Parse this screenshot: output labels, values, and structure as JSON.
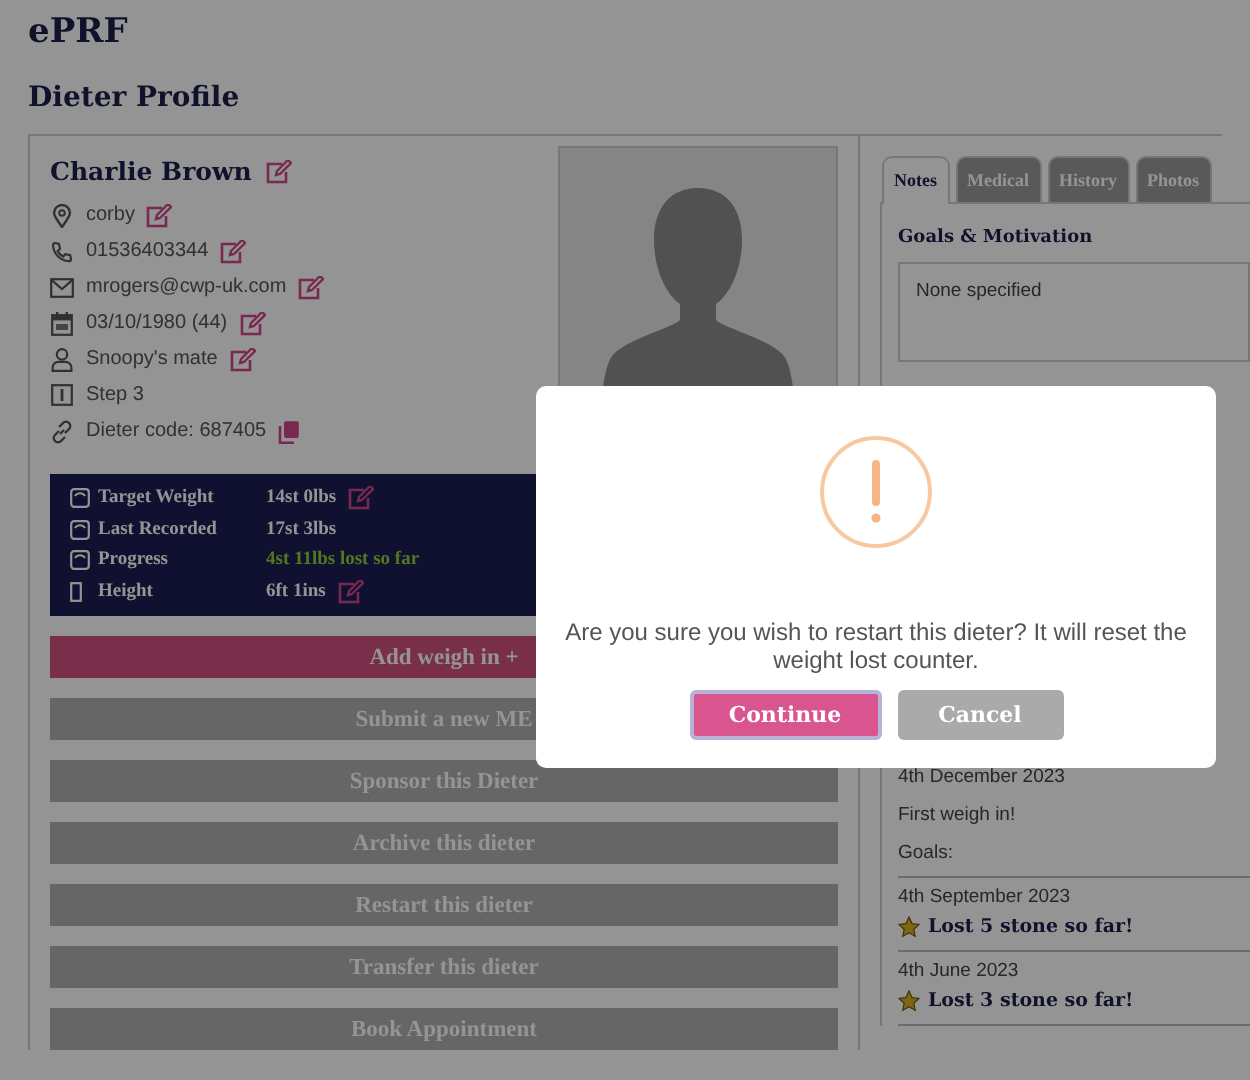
{
  "app": {
    "title": "ePRF"
  },
  "page_title": "Dieter Profile",
  "dieter": {
    "name": "Charlie Brown",
    "details": [
      {
        "kind": "location",
        "text": "corby",
        "editable": true,
        "copyable": false
      },
      {
        "kind": "phone",
        "text": "01536403344",
        "editable": true,
        "copyable": false
      },
      {
        "kind": "email",
        "text": "mrogers@cwp-uk.com",
        "editable": true,
        "copyable": false
      },
      {
        "kind": "calendar",
        "text": "03/10/1980 (44)",
        "editable": true,
        "copyable": false
      },
      {
        "kind": "person",
        "text": "Snoopy's mate",
        "editable": true,
        "copyable": false
      },
      {
        "kind": "info",
        "text": "Step 3",
        "editable": false,
        "copyable": false
      },
      {
        "kind": "link",
        "text": "Dieter code: 687405",
        "editable": false,
        "copyable": true
      }
    ]
  },
  "stats": [
    {
      "kind": "scale",
      "label": "Target Weight",
      "value": "14st 0lbs",
      "editable": true,
      "highlight": false
    },
    {
      "kind": "scale",
      "label": "Last Recorded",
      "value": "17st 3lbs",
      "editable": false,
      "highlight": false
    },
    {
      "kind": "scale",
      "label": "Progress",
      "value": "4st 11lbs lost so far",
      "editable": false,
      "highlight": true
    },
    {
      "kind": "ruler",
      "label": "Height",
      "value": "6ft 1ins",
      "editable": true,
      "highlight": false
    }
  ],
  "actions": [
    {
      "label": "Add weigh in +",
      "primary": true
    },
    {
      "label": "Submit a new ME",
      "primary": false
    },
    {
      "label": "Sponsor this Dieter",
      "primary": false
    },
    {
      "label": "Archive this dieter",
      "primary": false
    },
    {
      "label": "Restart this dieter",
      "primary": false
    },
    {
      "label": "Transfer this dieter",
      "primary": false
    },
    {
      "label": "Book Appointment",
      "primary": false
    }
  ],
  "tabs": [
    {
      "label": "Notes",
      "selected": true
    },
    {
      "label": "Medical",
      "selected": false
    },
    {
      "label": "History",
      "selected": false
    },
    {
      "label": "Photos",
      "selected": false
    }
  ],
  "notes": {
    "heading": "Goals & Motivation",
    "text": "None specified"
  },
  "history": [
    {
      "kind": "note",
      "date": "4th December 2023",
      "lines": [
        "First weigh in!",
        "Goals:"
      ]
    },
    {
      "kind": "award",
      "date": "4th September 2023",
      "lines": [
        "Lost 5 stone so far!"
      ]
    },
    {
      "kind": "award",
      "date": "4th June 2023",
      "lines": [
        "Lost 3 stone so far!"
      ]
    }
  ],
  "dialog": {
    "message": "Are you sure you wish to restart this dieter? It will reset the weight lost counter.",
    "buttons": [
      {
        "label": "Continue",
        "kind": "confirm",
        "focused": true
      },
      {
        "label": "Cancel",
        "kind": "cancel",
        "focused": false
      }
    ]
  }
}
